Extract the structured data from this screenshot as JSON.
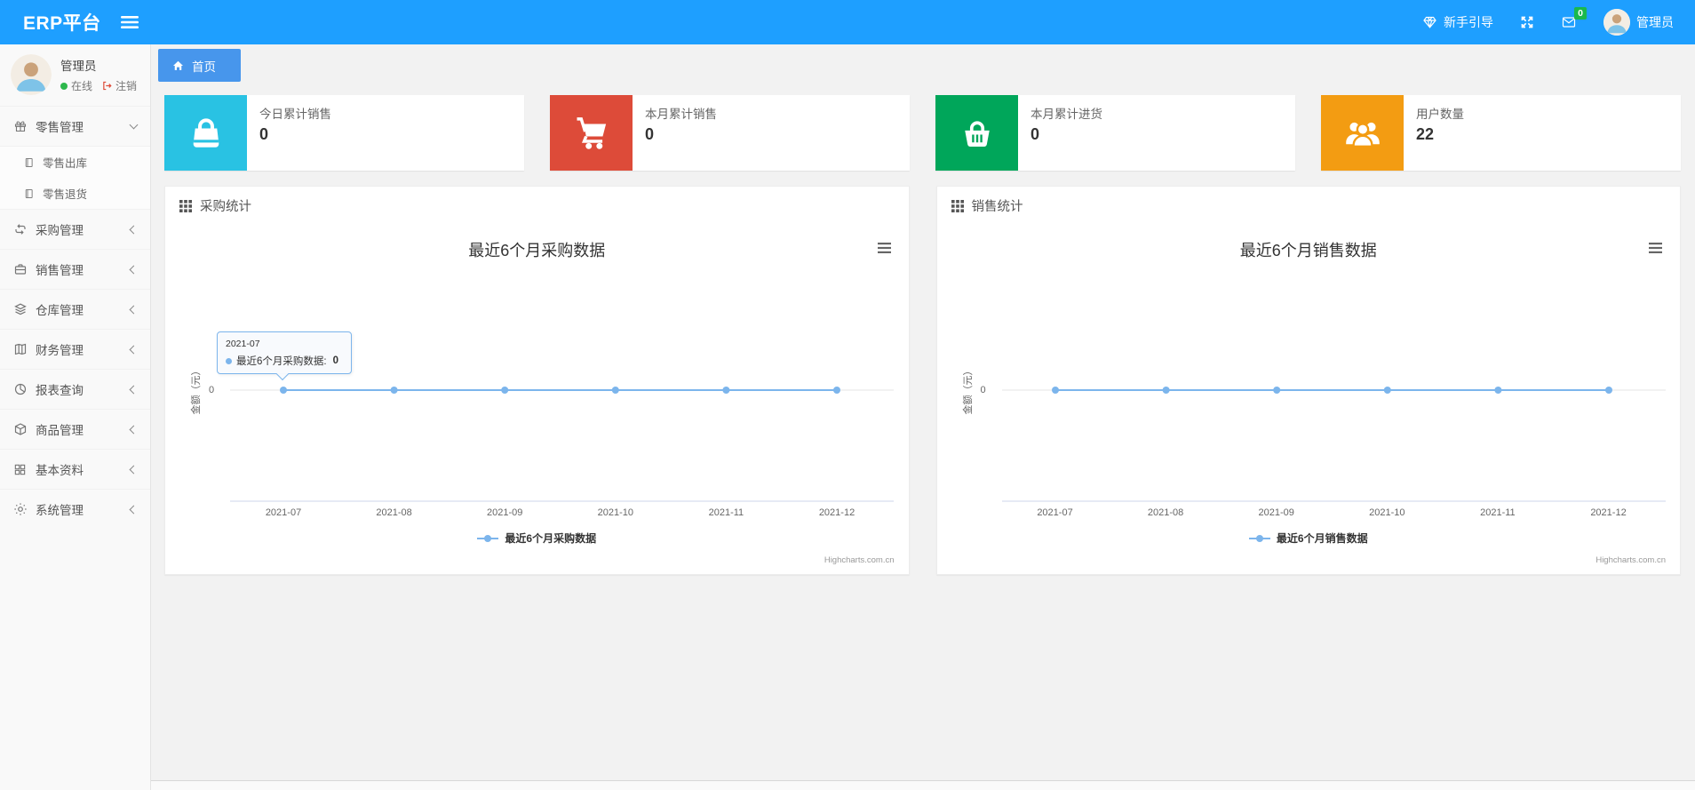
{
  "navbar": {
    "brand": "ERP平台",
    "guide": "新手引导",
    "message_count": "0",
    "user": "管理员"
  },
  "sidebar": {
    "user": {
      "name": "管理员",
      "status": "在线",
      "logout": "注销"
    },
    "menu": [
      {
        "label": "零售管理",
        "icon": "gift-icon",
        "state": "expanded",
        "children": [
          {
            "label": "零售出库",
            "icon": "document-icon"
          },
          {
            "label": "零售退货",
            "icon": "document-icon"
          }
        ]
      },
      {
        "label": "采购管理",
        "icon": "repeat-icon"
      },
      {
        "label": "销售管理",
        "icon": "briefcase-icon"
      },
      {
        "label": "仓库管理",
        "icon": "layers-icon"
      },
      {
        "label": "财务管理",
        "icon": "ledger-icon"
      },
      {
        "label": "报表查询",
        "icon": "pie-chart-icon"
      },
      {
        "label": "商品管理",
        "icon": "package-icon"
      },
      {
        "label": "基本资料",
        "icon": "grid-icon"
      },
      {
        "label": "系统管理",
        "icon": "gear-icon"
      }
    ]
  },
  "tabs": [
    {
      "label": "首页",
      "active": true
    }
  ],
  "stat_cards": [
    {
      "label": "今日累计销售",
      "value": "0",
      "color": "#29C2E3",
      "icon": "bag-icon"
    },
    {
      "label": "本月累计销售",
      "value": "0",
      "color": "#DD4B39",
      "icon": "cart-icon"
    },
    {
      "label": "本月累计进货",
      "value": "0",
      "color": "#00A65A",
      "icon": "basket-icon"
    },
    {
      "label": "用户数量",
      "value": "22",
      "color": "#F39C12",
      "icon": "users-icon"
    }
  ],
  "panels": [
    {
      "header": "采购统计"
    },
    {
      "header": "销售统计"
    }
  ],
  "colors": {
    "navbar_bg": "#1E9FFF",
    "tab_bg": "#4796EC",
    "badge_green": "#1AB94C",
    "series_blue": "#7CB5EC"
  },
  "chart_data": [
    {
      "type": "line",
      "title": "最近6个月采购数据",
      "categories": [
        "2021-07",
        "2021-08",
        "2021-09",
        "2021-10",
        "2021-11",
        "2021-12"
      ],
      "series": [
        {
          "name": "最近6个月采购数据",
          "values": [
            0,
            0,
            0,
            0,
            0,
            0
          ],
          "color": "#7CB5EC"
        }
      ],
      "ylabel": "金额（元）",
      "yticks": [
        "0"
      ],
      "grid": true,
      "legend_position": "bottom",
      "credit": "Highcharts.com.cn",
      "tooltip": {
        "visible": true,
        "point_index": 0,
        "header": "2021-07",
        "label": "最近6个月采购数据:",
        "value": "0"
      }
    },
    {
      "type": "line",
      "title": "最近6个月销售数据",
      "categories": [
        "2021-07",
        "2021-08",
        "2021-09",
        "2021-10",
        "2021-11",
        "2021-12"
      ],
      "series": [
        {
          "name": "最近6个月销售数据",
          "values": [
            0,
            0,
            0,
            0,
            0,
            0
          ],
          "color": "#7CB5EC"
        }
      ],
      "ylabel": "金额（元）",
      "yticks": [
        "0"
      ],
      "grid": true,
      "legend_position": "bottom",
      "credit": "Highcharts.com.cn",
      "tooltip": {
        "visible": false
      }
    }
  ]
}
